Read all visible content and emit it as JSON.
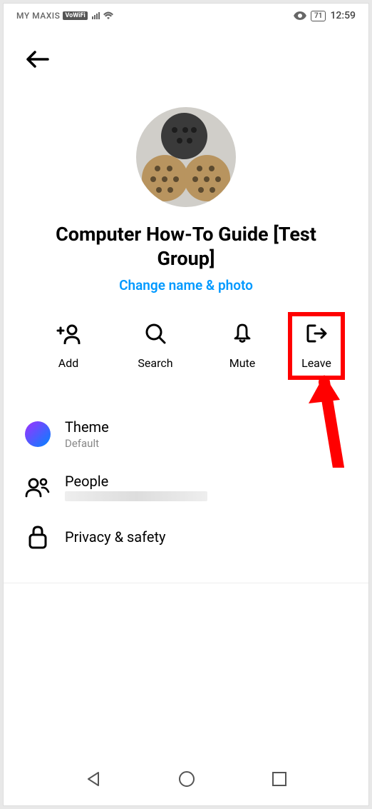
{
  "status": {
    "carrier": "MY MAXIS",
    "vowifi": "VoWiFi",
    "battery": "71",
    "time": "12:59"
  },
  "group": {
    "title": "Computer How-To Guide [Test Group]",
    "change_link": "Change name & photo"
  },
  "actions": {
    "add": "Add",
    "search": "Search",
    "mute": "Mute",
    "leave": "Leave"
  },
  "settings": {
    "theme": {
      "title": "Theme",
      "subtitle": "Default"
    },
    "people": {
      "title": "People"
    },
    "privacy": {
      "title": "Privacy & safety"
    }
  }
}
